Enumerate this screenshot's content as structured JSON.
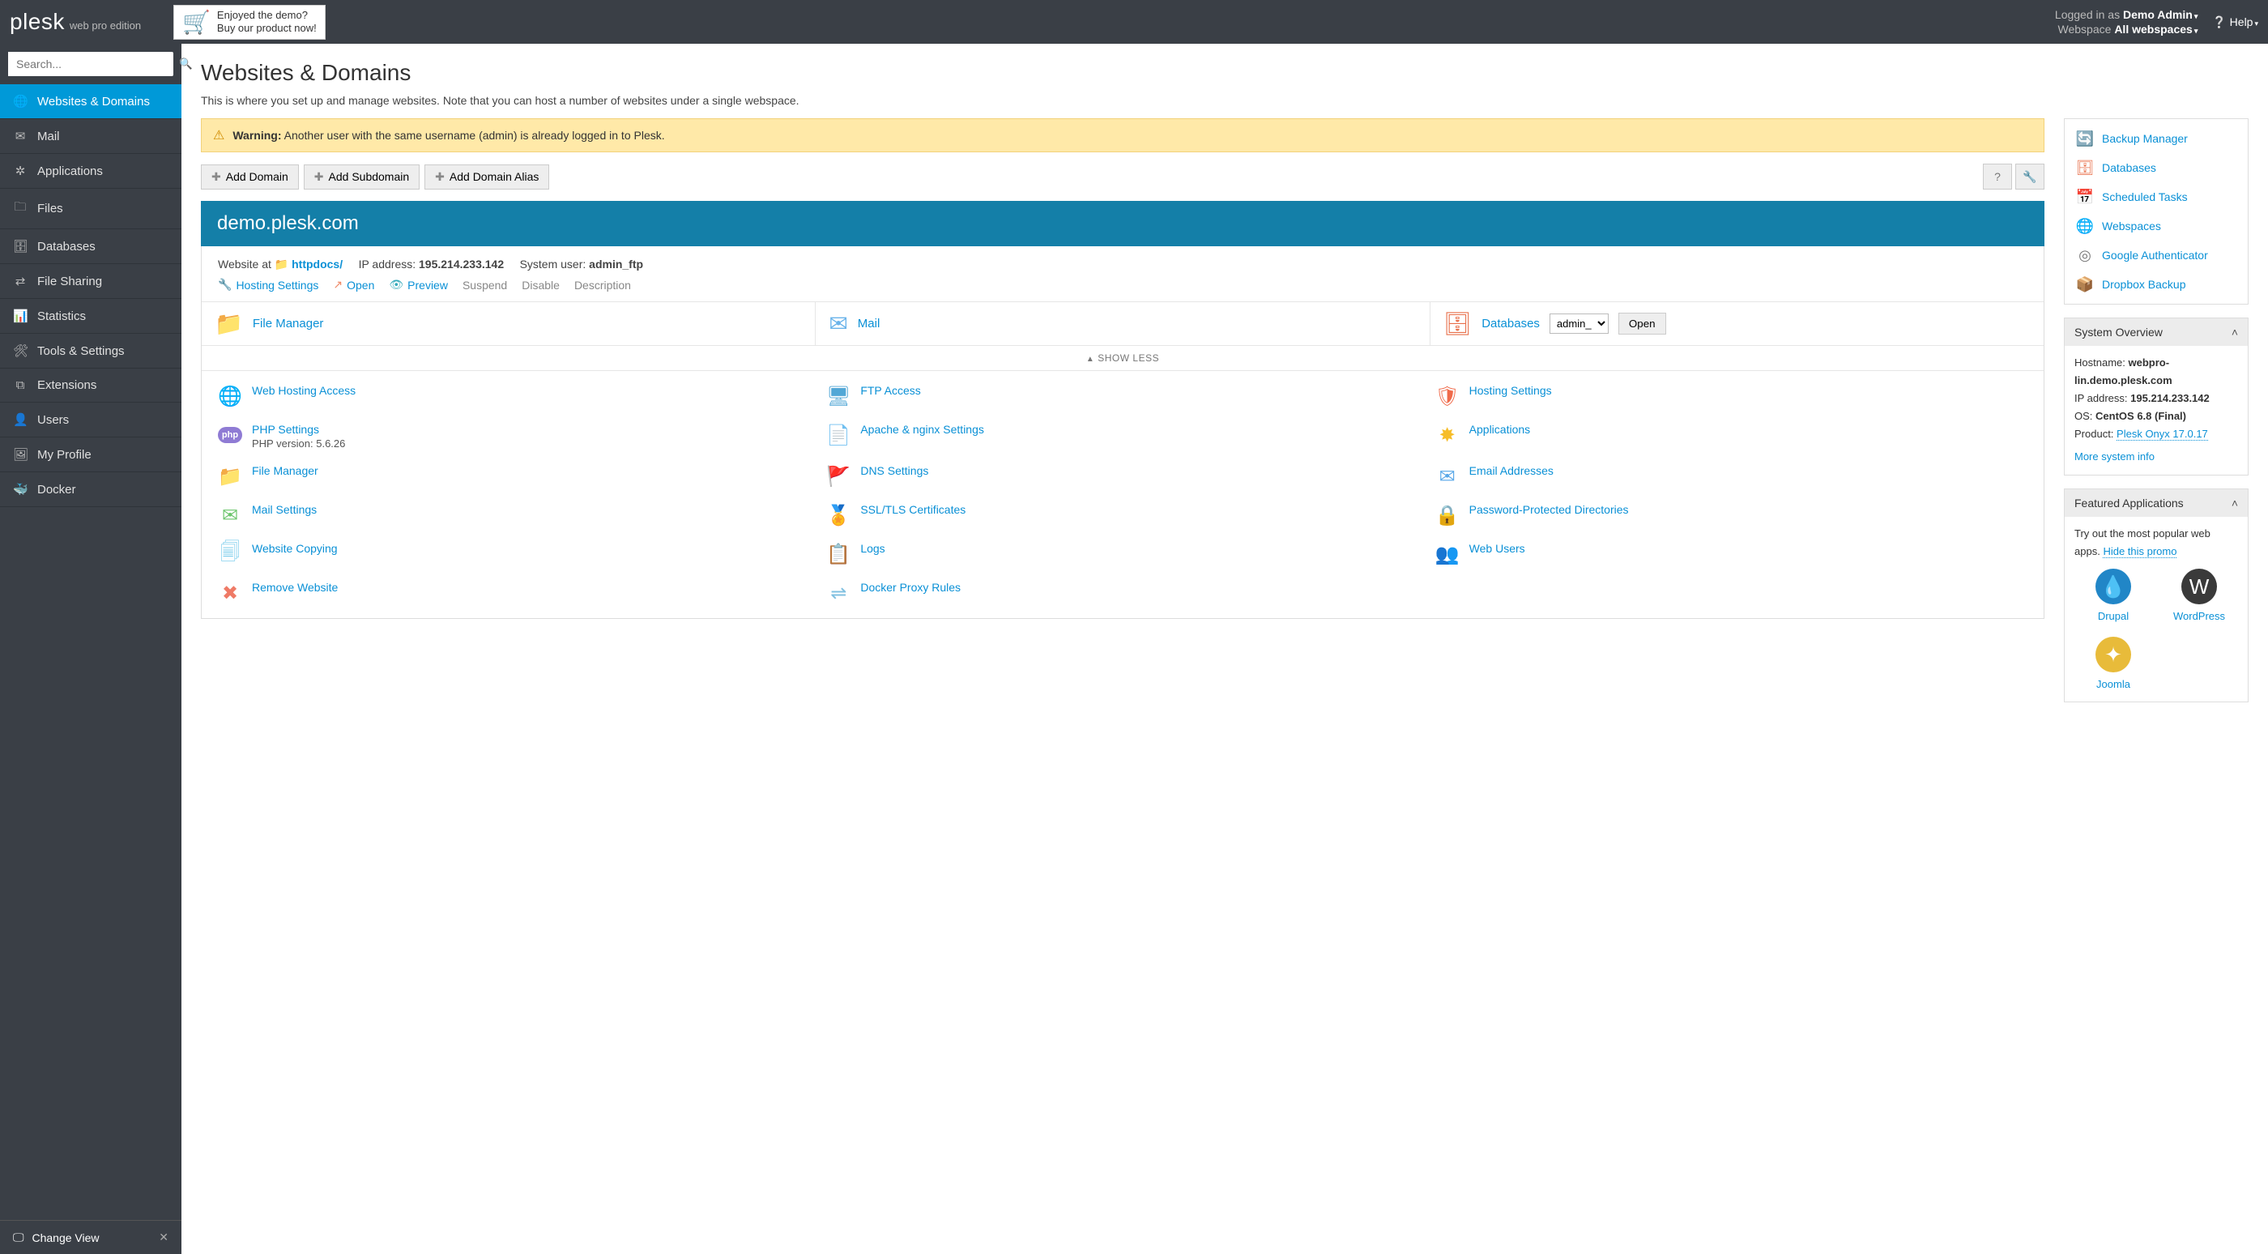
{
  "header": {
    "logo": "plesk",
    "edition": "web pro edition",
    "promo_line1": "Enjoyed the demo?",
    "promo_line2": "Buy our product now!",
    "logged_in_label": "Logged in as",
    "user": "Demo Admin",
    "webspace_label": "Webspace",
    "webspace_value": "All webspaces",
    "help": "Help"
  },
  "search": {
    "placeholder": "Search..."
  },
  "nav": {
    "items": [
      {
        "label": "Websites & Domains",
        "icon": "🌐"
      },
      {
        "label": "Mail",
        "icon": "✉"
      },
      {
        "label": "Applications",
        "icon": "✲"
      },
      {
        "label": "Files",
        "icon": "🗀"
      },
      {
        "label": "Databases",
        "icon": "🗄"
      },
      {
        "label": "File Sharing",
        "icon": "⇄"
      },
      {
        "label": "Statistics",
        "icon": "📊"
      },
      {
        "label": "Tools & Settings",
        "icon": "🛠"
      },
      {
        "label": "Extensions",
        "icon": "⧉"
      },
      {
        "label": "Users",
        "icon": "👤"
      },
      {
        "label": "My Profile",
        "icon": "🖼"
      },
      {
        "label": "Docker",
        "icon": "🐳"
      }
    ],
    "change_view": "Change View"
  },
  "page": {
    "title": "Websites & Domains",
    "description": "This is where you set up and manage websites. Note that you can host a number of websites under a single webspace."
  },
  "warning": {
    "label": "Warning:",
    "text": "Another user with the same username (admin) is already logged in to Plesk."
  },
  "toolbar": {
    "add_domain": "Add Domain",
    "add_subdomain": "Add Subdomain",
    "add_alias": "Add Domain Alias"
  },
  "domain": {
    "name": "demo.plesk.com",
    "website_at": "Website at",
    "httpdocs": "httpdocs/",
    "ip_label": "IP address:",
    "ip": "195.214.233.142",
    "user_label": "System user:",
    "user": "admin_ftp",
    "actions": {
      "hosting_settings": "Hosting Settings",
      "open": "Open",
      "preview": "Preview",
      "suspend": "Suspend",
      "disable": "Disable",
      "description": "Description"
    },
    "triple": {
      "file_manager": "File Manager",
      "mail": "Mail",
      "databases": "Databases",
      "db_selected": "admin_",
      "open": "Open"
    },
    "show_less": "SHOW LESS",
    "tiles": [
      {
        "label": "Web Hosting Access",
        "icon": "🌐",
        "color": "#3ab0e8"
      },
      {
        "label": "FTP Access",
        "icon": "🖥",
        "color": "#52a7d6"
      },
      {
        "label": "Hosting Settings",
        "icon": "🛡",
        "color": "#f06a4a"
      },
      {
        "label": "PHP Settings",
        "sub": "PHP version: 5.6.26",
        "icon": "php",
        "color": "#8f7bd4"
      },
      {
        "label": "Apache & nginx Settings",
        "icon": "📄",
        "color": "#57b5e6"
      },
      {
        "label": "Applications",
        "icon": "✸",
        "color": "#f6bd2a"
      },
      {
        "label": "File Manager",
        "icon": "📁",
        "color": "#ffa43b"
      },
      {
        "label": "DNS Settings",
        "icon": "🚩",
        "color": "#5bb85c"
      },
      {
        "label": "Email Addresses",
        "icon": "✉",
        "color": "#5aa8e8"
      },
      {
        "label": "Mail Settings",
        "icon": "✉",
        "color": "#6cc56c"
      },
      {
        "label": "SSL/TLS Certificates",
        "icon": "🏅",
        "color": "#f4bb2e"
      },
      {
        "label": "Password-Protected Directories",
        "icon": "🔒",
        "color": "#f0884a"
      },
      {
        "label": "Website Copying",
        "icon": "🗐",
        "color": "#6cc7ea"
      },
      {
        "label": "Logs",
        "icon": "📋",
        "color": "#82bfe8"
      },
      {
        "label": "Web Users",
        "icon": "👥",
        "color": "#68b4e4"
      },
      {
        "label": "Remove Website",
        "icon": "✖",
        "color": "#ef7a66"
      },
      {
        "label": "Docker Proxy Rules",
        "icon": "⇌",
        "color": "#80c0e0"
      }
    ]
  },
  "side_links": [
    {
      "label": "Backup Manager",
      "icon": "🔄",
      "color": "#5a93b8"
    },
    {
      "label": "Databases",
      "icon": "🗄",
      "color": "#e86f4a"
    },
    {
      "label": "Scheduled Tasks",
      "icon": "📅",
      "color": "#ff6a4a"
    },
    {
      "label": "Webspaces",
      "icon": "🌐",
      "color": "#4aa3de"
    },
    {
      "label": "Google Authenticator",
      "icon": "◎",
      "color": "#777"
    },
    {
      "label": "Dropbox Backup",
      "icon": "📦",
      "color": "#3a9de8"
    }
  ],
  "overview": {
    "title": "System Overview",
    "hostname_label": "Hostname:",
    "hostname": "webpro-lin.demo.plesk.com",
    "ip_label": "IP address:",
    "ip": "195.214.233.142",
    "os_label": "OS:",
    "os": "CentOS 6.8 (Final)",
    "product_label": "Product:",
    "product": "Plesk Onyx 17.0.17",
    "more": "More system info"
  },
  "featured": {
    "title": "Featured Applications",
    "intro": "Try out the most popular web apps.",
    "hide": "Hide this promo",
    "apps": [
      {
        "name": "Drupal",
        "icon": "💧",
        "bg": "#2186c7"
      },
      {
        "name": "WordPress",
        "icon": "W",
        "bg": "#3a3a3a"
      },
      {
        "name": "Joomla",
        "icon": "✦",
        "bg": "#e8bb3a"
      }
    ]
  }
}
